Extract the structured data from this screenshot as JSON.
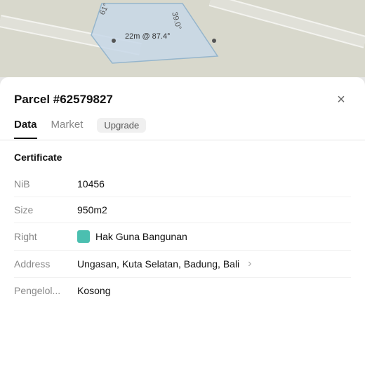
{
  "map": {
    "label": "22m @ 87.4°",
    "angle1": "61°",
    "angle2": "39.0°"
  },
  "panel": {
    "title": "Parcel #62579827",
    "close_label": "×",
    "tabs": [
      {
        "label": "Data",
        "active": true
      },
      {
        "label": "Market",
        "active": false
      },
      {
        "label": "Upgrade",
        "badge": true
      }
    ],
    "section": "Certificate",
    "rows": [
      {
        "label": "NiB",
        "value": "10456"
      },
      {
        "label": "Size",
        "value": "950m2"
      },
      {
        "label": "Right",
        "value": "Hak Guna Bangunan",
        "color": "#4BBFB0"
      },
      {
        "label": "Address",
        "value": "Ungasan, Kuta Selatan, Badung, Bali",
        "chevron": true
      },
      {
        "label": "Pengelol...",
        "value": "Kosong"
      }
    ]
  }
}
